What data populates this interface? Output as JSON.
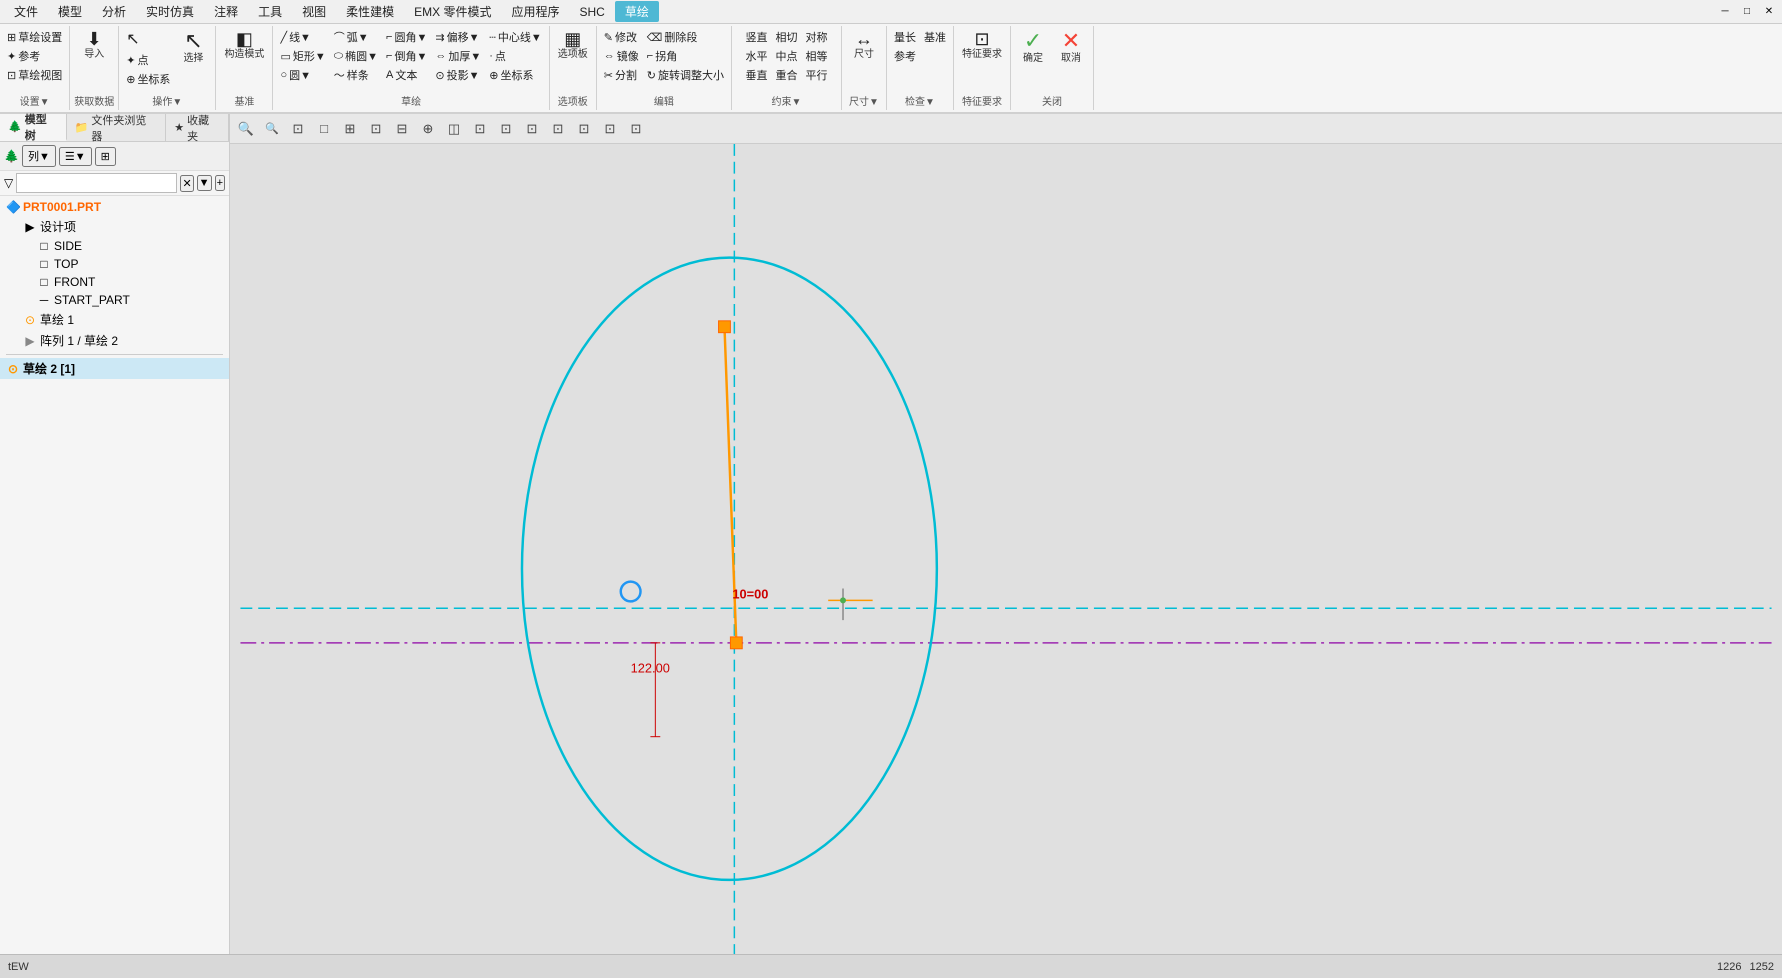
{
  "menubar": {
    "items": [
      "文件",
      "模型",
      "分析",
      "实时仿真",
      "注释",
      "工具",
      "视图",
      "柔性建模",
      "EMX 零件模式",
      "应用程序",
      "SHC",
      "草绘"
    ],
    "active_index": 11
  },
  "ribbon": {
    "groups": [
      {
        "label": "设置▼",
        "buttons": [
          {
            "label": "草绘设置",
            "icon": "⊞"
          },
          {
            "label": "参考",
            "icon": "⊹"
          },
          {
            "label": "草绘视图",
            "icon": "⊡"
          }
        ],
        "small_buttons": [],
        "sub_label": "设置▼"
      },
      {
        "label": "获取数据",
        "buttons": [
          {
            "label": "导入",
            "icon": "⇩"
          }
        ],
        "sub_label": "获取数据"
      },
      {
        "label": "操作▼",
        "buttons": [
          {
            "label": "选择",
            "icon": "↖"
          }
        ],
        "sub_label": "操作▼"
      },
      {
        "label": "基准",
        "buttons": [
          {
            "label": "构造模式",
            "icon": "◫"
          }
        ],
        "sub_label": "基准"
      },
      {
        "label": "草绘",
        "rows": [
          [
            "线▼",
            "弧▼",
            "圆角▼",
            "偏移▼",
            "中心线▼"
          ],
          [
            "矩形▼",
            "椭圆▼",
            "倒角▼",
            "加厚▼",
            "点"
          ],
          [
            "圆▼",
            "",
            "样条",
            "文本",
            "投影▼",
            "坐标系"
          ]
        ],
        "sub_label": "草绘"
      },
      {
        "label": "选项板",
        "buttons": [
          {
            "label": "选项板",
            "icon": "▦"
          }
        ],
        "sub_label": "选项板"
      },
      {
        "label": "编辑",
        "rows": [
          [
            "修改",
            "删除段"
          ],
          [
            "镜像",
            "拐角"
          ],
          [
            "分割",
            "旋转调整大小"
          ]
        ],
        "sub_label": "编辑"
      },
      {
        "label": "约束▼",
        "rows": [
          [
            "竖直",
            "相切",
            "对称"
          ],
          [
            "水平",
            "中点",
            "相等"
          ],
          [
            "垂直",
            "重合",
            "平行"
          ]
        ],
        "sub_label": "约束▼"
      },
      {
        "label": "尺寸▼",
        "buttons": [
          {
            "label": "尺寸",
            "icon": "↔"
          }
        ],
        "sub_label": "尺寸▼"
      },
      {
        "label": "检查▼",
        "rows": [
          [
            "量长",
            "基准"
          ],
          [
            "参考"
          ]
        ],
        "sub_label": "检查▼"
      },
      {
        "label": "特征要求",
        "buttons": [
          {
            "label": "特征要求",
            "icon": "⊞"
          }
        ],
        "sub_label": "特征要求"
      },
      {
        "label": "关闭",
        "buttons": [
          {
            "label": "确定",
            "icon": "✓",
            "color": "green"
          },
          {
            "label": "取消",
            "icon": "✕",
            "color": "red"
          }
        ],
        "sub_label": "关闭"
      }
    ]
  },
  "left_panel": {
    "tabs": [
      "模型树",
      "文件夹浏览器",
      "收藏夹"
    ],
    "active_tab": 0,
    "tree_items": [
      {
        "level": 0,
        "icon": "🔶",
        "label": "PRT0001.PRT",
        "type": "file"
      },
      {
        "level": 1,
        "icon": "📁",
        "label": "设计项",
        "type": "folder"
      },
      {
        "level": 2,
        "icon": "□",
        "label": "SIDE",
        "type": "plane"
      },
      {
        "level": 2,
        "icon": "□",
        "label": "TOP",
        "type": "plane"
      },
      {
        "level": 2,
        "icon": "□",
        "label": "FRONT",
        "type": "plane"
      },
      {
        "level": 2,
        "icon": "─",
        "label": "START_PART",
        "type": "item"
      },
      {
        "level": 1,
        "icon": "⊙",
        "label": "草绘 1",
        "type": "sketch"
      },
      {
        "level": 1,
        "icon": "▶",
        "label": "阵列 1 / 草绘 2",
        "type": "array"
      },
      {
        "level": 0,
        "icon": "⊙",
        "label": "草绘 2 [1]",
        "type": "sketch",
        "active": true
      }
    ],
    "filter_placeholder": ""
  },
  "canvas": {
    "view_buttons": [
      "🔍+",
      "🔍-",
      "□",
      "⊡",
      "⊞",
      "⊡",
      "⊡",
      "⊡",
      "⊡",
      "⊡",
      "⊡",
      "⊡",
      "⊡",
      "⊡",
      "⊡",
      "⊡"
    ],
    "dimension_label": "122.00",
    "constraint_label": "10=00"
  },
  "statusbar": {
    "left_text": "tEW",
    "right_items": [
      "1226",
      "1252"
    ]
  },
  "colors": {
    "accent": "#4eb8d4",
    "green": "#4caf50",
    "red": "#f44336",
    "canvas_bg": "#d8d8d8",
    "ellipse_stroke": "#00bcd4",
    "orange_line": "#ff9800",
    "purple_dash": "#9c27b0",
    "teal_dash": "#00bcd4"
  }
}
